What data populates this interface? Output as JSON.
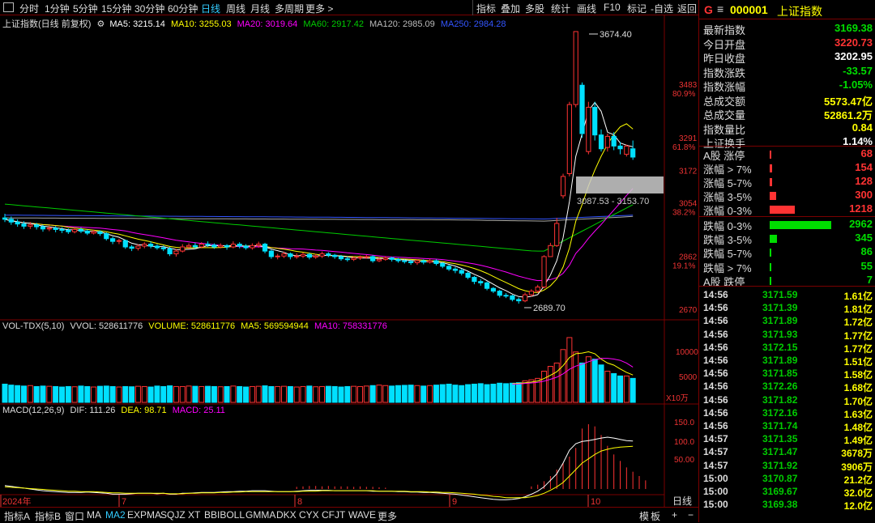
{
  "toolbar": {
    "periods": [
      "分时",
      "1分钟",
      "5分钟",
      "15分钟",
      "30分钟",
      "60分钟",
      "日线",
      "周线",
      "月线",
      "多周期",
      "更多 >"
    ],
    "active_period": "日线",
    "tools": [
      "指标",
      "叠加",
      "多股",
      "统计",
      "画线",
      "F10",
      "标记",
      "-自选",
      "返回"
    ]
  },
  "main_legend": {
    "title": "上证指数(日线 前复权)",
    "ma5": "MA5: 3215.14",
    "ma10": "MA10: 3255.03",
    "ma20": "MA20: 3019.64",
    "ma60": "MA60: 2917.42",
    "ma120": "MA120: 2985.09",
    "ma250": "MA250: 2984.28"
  },
  "price_axis": [
    {
      "price": "3483",
      "pct": "80.9%"
    },
    {
      "price": "3291",
      "pct": "61.8%"
    },
    {
      "price": "3172",
      "pct": ""
    },
    {
      "price": "3054",
      "pct": "38.2%"
    },
    {
      "price": "2862",
      "pct": "19.1%"
    },
    {
      "price": "2670",
      "pct": ""
    }
  ],
  "annotations": {
    "high": "3674.40",
    "low": "2689.70",
    "gap": "3087.53 - 3153.70"
  },
  "vol_legend": {
    "title": "VOL-TDX(5,10)",
    "vvol": "VVOL: 528611776",
    "volume": "VOLUME: 528611776",
    "ma5": "MA5: 569594944",
    "ma10": "MA10: 758331776"
  },
  "vol_axis": [
    "10000",
    "5000"
  ],
  "vol_unit": "X10万",
  "macd_legend": {
    "title": "MACD(12,26,9)",
    "dif": "DIF: 111.26",
    "dea": "DEA: 98.71",
    "macd": "MACD: 25.11"
  },
  "macd_axis": [
    "150.0",
    "100.0",
    "50.00"
  ],
  "date_labels": [
    "2024年",
    "7",
    "8",
    "9",
    "10"
  ],
  "corner_label": "日线",
  "bottom_tabs": [
    "指标A",
    "指标B",
    "窗口",
    "MA",
    "MA2",
    "EXPMA",
    "SQJZ",
    "XT",
    "BBIBOLL",
    "GMMA",
    "DKX",
    "CYX",
    "CFJT",
    "WAVE",
    "更多"
  ],
  "bottom_active": "MA2",
  "bottom_right": [
    "模",
    "板",
    "+",
    "−"
  ],
  "colors": {
    "up": "#ff3333",
    "down": "#00e0ff",
    "ma5": "#ffffff",
    "ma10": "#ffff00",
    "ma20": "#ff00ff",
    "ma60": "#00cc00",
    "ma120": "#aaaaaa",
    "ma250": "#3355ff"
  },
  "chart_data": {
    "type": "candlestick",
    "ylim": [
      2640,
      3720
    ],
    "candles": [
      [
        3000,
        2995,
        3015,
        2985
      ],
      [
        2995,
        2985,
        3005,
        2975
      ],
      [
        2985,
        2978,
        2995,
        2968
      ],
      [
        2978,
        2970,
        2988,
        2960
      ],
      [
        2970,
        2975,
        2985,
        2960
      ],
      [
        2975,
        2968,
        2982,
        2958
      ],
      [
        2968,
        2960,
        2975,
        2950
      ],
      [
        2960,
        2963,
        2972,
        2952
      ],
      [
        2963,
        2958,
        2970,
        2948
      ],
      [
        2958,
        2955,
        2966,
        2945
      ],
      [
        2955,
        2950,
        2962,
        2942
      ],
      [
        2950,
        2958,
        2966,
        2944
      ],
      [
        2958,
        2952,
        2965,
        2945
      ],
      [
        2952,
        2945,
        2958,
        2938
      ],
      [
        2945,
        2950,
        2958,
        2940
      ],
      [
        2950,
        2943,
        2955,
        2935
      ],
      [
        2943,
        2925,
        2948,
        2918
      ],
      [
        2925,
        2915,
        2932,
        2905
      ],
      [
        2915,
        2918,
        2925,
        2905
      ],
      [
        2918,
        2895,
        2922,
        2888
      ],
      [
        2895,
        2890,
        2902,
        2880
      ],
      [
        2890,
        2898,
        2905,
        2882
      ],
      [
        2898,
        2905,
        2912,
        2890
      ],
      [
        2905,
        2898,
        2915,
        2890
      ],
      [
        2898,
        2892,
        2905,
        2885
      ],
      [
        2892,
        2888,
        2900,
        2880
      ],
      [
        2888,
        2870,
        2895,
        2862
      ],
      [
        2870,
        2880,
        2888,
        2860
      ],
      [
        2880,
        2895,
        2905,
        2875
      ],
      [
        2895,
        2900,
        2908,
        2888
      ],
      [
        2900,
        2895,
        2910,
        2888
      ],
      [
        2895,
        2905,
        2912,
        2890
      ],
      [
        2905,
        2902,
        2915,
        2895
      ],
      [
        2902,
        2895,
        2908,
        2888
      ],
      [
        2895,
        2900,
        2908,
        2890
      ],
      [
        2900,
        2895,
        2905,
        2885
      ],
      [
        2895,
        2905,
        2915,
        2890
      ],
      [
        2905,
        2898,
        2912,
        2890
      ],
      [
        2898,
        2892,
        2905,
        2885
      ],
      [
        2892,
        2900,
        2908,
        2885
      ],
      [
        2900,
        2905,
        2914,
        2892
      ],
      [
        2905,
        2880,
        2910,
        2872
      ],
      [
        2880,
        2860,
        2885,
        2852
      ],
      [
        2860,
        2862,
        2870,
        2850
      ],
      [
        2862,
        2870,
        2878,
        2855
      ],
      [
        2870,
        2860,
        2875,
        2850
      ],
      [
        2860,
        2862,
        2872,
        2852
      ],
      [
        2862,
        2868,
        2875,
        2855
      ],
      [
        2868,
        2858,
        2874,
        2850
      ],
      [
        2858,
        2862,
        2870,
        2852
      ],
      [
        2862,
        2870,
        2878,
        2855
      ],
      [
        2870,
        2865,
        2876,
        2858
      ],
      [
        2865,
        2860,
        2870,
        2852
      ],
      [
        2860,
        2852,
        2866,
        2845
      ],
      [
        2852,
        2850,
        2860,
        2842
      ],
      [
        2850,
        2855,
        2862,
        2844
      ],
      [
        2855,
        2858,
        2864,
        2848
      ],
      [
        2858,
        2860,
        2866,
        2852
      ],
      [
        2860,
        2845,
        2865,
        2838
      ],
      [
        2845,
        2850,
        2858,
        2840
      ],
      [
        2850,
        2855,
        2862,
        2845
      ],
      [
        2855,
        2850,
        2860,
        2842
      ],
      [
        2850,
        2845,
        2855,
        2838
      ],
      [
        2845,
        2842,
        2850,
        2835
      ],
      [
        2842,
        2838,
        2848,
        2830
      ],
      [
        2838,
        2845,
        2850,
        2830
      ],
      [
        2845,
        2840,
        2850,
        2832
      ],
      [
        2840,
        2845,
        2852,
        2835
      ],
      [
        2845,
        2835,
        2850,
        2828
      ],
      [
        2835,
        2825,
        2840,
        2818
      ],
      [
        2825,
        2815,
        2830,
        2808
      ],
      [
        2815,
        2810,
        2822,
        2800
      ],
      [
        2810,
        2800,
        2816,
        2792
      ],
      [
        2800,
        2785,
        2806,
        2778
      ],
      [
        2785,
        2770,
        2790,
        2760
      ],
      [
        2770,
        2765,
        2778,
        2755
      ],
      [
        2765,
        2745,
        2770,
        2738
      ],
      [
        2745,
        2735,
        2750,
        2728
      ],
      [
        2735,
        2720,
        2740,
        2712
      ],
      [
        2720,
        2718,
        2728,
        2710
      ],
      [
        2718,
        2705,
        2722,
        2698
      ],
      [
        2705,
        2700,
        2712,
        2690
      ],
      [
        2700,
        2722,
        2730,
        2695
      ],
      [
        2722,
        2735,
        2742,
        2715
      ],
      [
        2735,
        2750,
        2758,
        2728
      ],
      [
        2750,
        2860,
        2865,
        2745
      ],
      [
        2860,
        2900,
        2910,
        2860
      ],
      [
        2900,
        2980,
        3000,
        2895
      ],
      [
        3080,
        3150,
        3160,
        3070
      ],
      [
        3160,
        3410,
        3420,
        3150
      ],
      [
        3410,
        3674,
        3674,
        3400
      ],
      [
        3480,
        3305,
        3490,
        3290
      ],
      [
        3240,
        3400,
        3420,
        3230
      ],
      [
        3400,
        3300,
        3420,
        3280
      ],
      [
        3300,
        3250,
        3320,
        3240
      ],
      [
        3255,
        3295,
        3305,
        3240
      ],
      [
        3295,
        3260,
        3310,
        3245
      ],
      [
        3260,
        3250,
        3275,
        3230
      ],
      [
        3230,
        3260,
        3265,
        3222
      ],
      [
        3250,
        3220,
        3280,
        3210
      ]
    ],
    "volume": [
      3800,
      3600,
      3500,
      3400,
      3500,
      3300,
      3400,
      3350,
      3300,
      3200,
      3300,
      3250,
      3400,
      3300,
      3200,
      3350,
      3400,
      3300,
      3200,
      3300,
      3250,
      3350,
      3300,
      3200,
      3400,
      3300,
      3450,
      3300,
      3300,
      3400,
      3350,
      3300,
      3350,
      3300,
      3250,
      3300,
      3400,
      3300,
      3200,
      3300,
      3350,
      3450,
      3300,
      3300,
      3350,
      3300,
      3200,
      3300,
      3400,
      3250,
      3300,
      3350,
      3300,
      3200,
      3300,
      3350,
      3300,
      3400,
      3500,
      3600,
      3500,
      3400,
      3500,
      3550,
      3600,
      3500,
      3400,
      3500,
      3600,
      3700,
      3800,
      3600,
      3500,
      3700,
      3800,
      3900,
      3700,
      3800,
      4000,
      3900,
      4000,
      4100,
      4500,
      4700,
      5000,
      6500,
      7500,
      8200,
      11000,
      13500,
      10500,
      8200,
      9500,
      9000,
      7800,
      6500,
      6000,
      5500,
      5500,
      5000
    ],
    "macd": {
      "bars": [
        0,
        0,
        0,
        0,
        0,
        0,
        0,
        0,
        0,
        0,
        0,
        0,
        0,
        0,
        0,
        0,
        0,
        0,
        0,
        0,
        0,
        0,
        0,
        0,
        0,
        0,
        0,
        0,
        0,
        0,
        0,
        0,
        0,
        0,
        0,
        0,
        0,
        0,
        0,
        0,
        0,
        0,
        0,
        0,
        0,
        0,
        5,
        6,
        7,
        7,
        6,
        7,
        6,
        6,
        6,
        5,
        6,
        5,
        5,
        4,
        3,
        0,
        0,
        0,
        0,
        0,
        0,
        0,
        0,
        0,
        0,
        0,
        0,
        0,
        0,
        0,
        0,
        0,
        0,
        0,
        0,
        0,
        0,
        6,
        10,
        18,
        30,
        45,
        60,
        75,
        95,
        140,
        150,
        145,
        125,
        100,
        80,
        65,
        50,
        40,
        30,
        20
      ],
      "dif": [
        8,
        6,
        4,
        2,
        0,
        -2,
        -4,
        -5,
        -6,
        -7,
        -8,
        -8,
        -8,
        -7,
        -8,
        -9,
        -10,
        -12,
        -12,
        -12,
        -11,
        -10,
        -10,
        -10,
        -11,
        -10,
        -12,
        -12,
        -10,
        -10,
        -9,
        -8,
        -8,
        -8,
        -7,
        -6,
        -6,
        -5,
        -5,
        -4,
        -4,
        -4,
        -5,
        -6,
        -6,
        -6,
        -5,
        -4,
        -3,
        -3,
        -3,
        -3,
        -4,
        -4,
        -4,
        -4,
        -4,
        -4,
        -5,
        -5,
        -5,
        -5,
        -6,
        -6,
        -7,
        -7,
        -8,
        -8,
        -9,
        -10,
        -11,
        -12,
        -14,
        -16,
        -18,
        -20,
        -22,
        -24,
        -25,
        -25,
        -24,
        -22,
        -18,
        -12,
        -5,
        5,
        20,
        35,
        60,
        90,
        105,
        110,
        112,
        115,
        118,
        120,
        118,
        115,
        112,
        111
      ],
      "dea": [
        5,
        4,
        3,
        2,
        1,
        0,
        -1,
        -2,
        -3,
        -4,
        -5,
        -5,
        -6,
        -6,
        -6,
        -7,
        -8,
        -9,
        -9,
        -10,
        -10,
        -10,
        -10,
        -10,
        -10,
        -10,
        -11,
        -11,
        -11,
        -10,
        -10,
        -9,
        -9,
        -9,
        -8,
        -8,
        -7,
        -7,
        -6,
        -6,
        -6,
        -6,
        -6,
        -6,
        -6,
        -6,
        -6,
        -5,
        -5,
        -5,
        -4,
        -4,
        -4,
        -4,
        -4,
        -4,
        -4,
        -4,
        -4,
        -5,
        -5,
        -5,
        -5,
        -5,
        -6,
        -6,
        -6,
        -7,
        -7,
        -8,
        -8,
        -9,
        -10,
        -11,
        -12,
        -14,
        -15,
        -17,
        -18,
        -20,
        -20,
        -20,
        -20,
        -18,
        -15,
        -10,
        -3,
        5,
        15,
        30,
        45,
        60,
        70,
        80,
        88,
        92,
        95,
        97,
        98,
        99
      ]
    }
  },
  "quote": {
    "g": "G",
    "menu": "≡",
    "code": "000001",
    "name": "上证指数",
    "rows": [
      {
        "label": "最新指数",
        "value": "3169.38",
        "color": "#00dd00"
      },
      {
        "label": "今日开盘",
        "value": "3220.73",
        "color": "#ff3333"
      },
      {
        "label": "昨日收盘",
        "value": "3202.95",
        "color": "#ffffff"
      },
      {
        "label": "指数涨跌",
        "value": "-33.57",
        "color": "#00dd00"
      },
      {
        "label": "指数涨幅",
        "value": "-1.05%",
        "color": "#00dd00"
      },
      {
        "label": "总成交额",
        "value": "5573.47亿",
        "color": "#ffff00"
      },
      {
        "label": "总成交量",
        "value": "52861.2万",
        "color": "#ffff00"
      },
      {
        "label": "指数量比",
        "value": "0.84",
        "color": "#ffff00"
      },
      {
        "label": "上证换手",
        "value": "1.14%",
        "color": "#ffffff"
      }
    ],
    "breadth": [
      {
        "label": "A股 涨停",
        "value": "68",
        "color": "#ff3333",
        "bar": 0.02
      },
      {
        "label": "涨幅 > 7%",
        "value": "154",
        "color": "#ff3333",
        "bar": 0.04
      },
      {
        "label": "涨幅 5-7%",
        "value": "128",
        "color": "#ff3333",
        "bar": 0.035
      },
      {
        "label": "涨幅 3-5%",
        "value": "300",
        "color": "#ff3333",
        "bar": 0.1
      },
      {
        "label": "涨幅 0-3%",
        "value": "1218",
        "color": "#ff3333",
        "bar": 0.41
      },
      {
        "label": "跌幅 0-3%",
        "value": "2962",
        "color": "#00dd00",
        "bar": 1.0
      },
      {
        "label": "跌幅 3-5%",
        "value": "345",
        "color": "#00dd00",
        "bar": 0.12
      },
      {
        "label": "跌幅 5-7%",
        "value": "86",
        "color": "#00dd00",
        "bar": 0.025
      },
      {
        "label": "跌幅 > 7%",
        "value": "55",
        "color": "#00dd00",
        "bar": 0.02
      },
      {
        "label": "A股 跌停",
        "value": "7",
        "color": "#00dd00",
        "bar": 0.01
      }
    ],
    "ticks": [
      {
        "t": "14:56",
        "p": "3171.59",
        "v": "1.61亿"
      },
      {
        "t": "14:56",
        "p": "3171.39",
        "v": "1.81亿"
      },
      {
        "t": "14:56",
        "p": "3171.89",
        "v": "1.72亿"
      },
      {
        "t": "14:56",
        "p": "3171.93",
        "v": "1.77亿"
      },
      {
        "t": "14:56",
        "p": "3172.15",
        "v": "1.77亿"
      },
      {
        "t": "14:56",
        "p": "3171.89",
        "v": "1.51亿"
      },
      {
        "t": "14:56",
        "p": "3171.85",
        "v": "1.58亿"
      },
      {
        "t": "14:56",
        "p": "3172.26",
        "v": "1.68亿"
      },
      {
        "t": "14:56",
        "p": "3171.82",
        "v": "1.70亿"
      },
      {
        "t": "14:56",
        "p": "3172.16",
        "v": "1.63亿"
      },
      {
        "t": "14:56",
        "p": "3171.74",
        "v": "1.48亿"
      },
      {
        "t": "14:57",
        "p": "3171.35",
        "v": "1.49亿"
      },
      {
        "t": "14:57",
        "p": "3171.47",
        "v": "3678万"
      },
      {
        "t": "14:57",
        "p": "3171.92",
        "v": "3906万"
      },
      {
        "t": "15:00",
        "p": "3170.87",
        "v": "21.2亿"
      },
      {
        "t": "15:00",
        "p": "3169.67",
        "v": "32.0亿"
      },
      {
        "t": "15:00",
        "p": "3169.38",
        "v": "12.0亿"
      }
    ]
  }
}
